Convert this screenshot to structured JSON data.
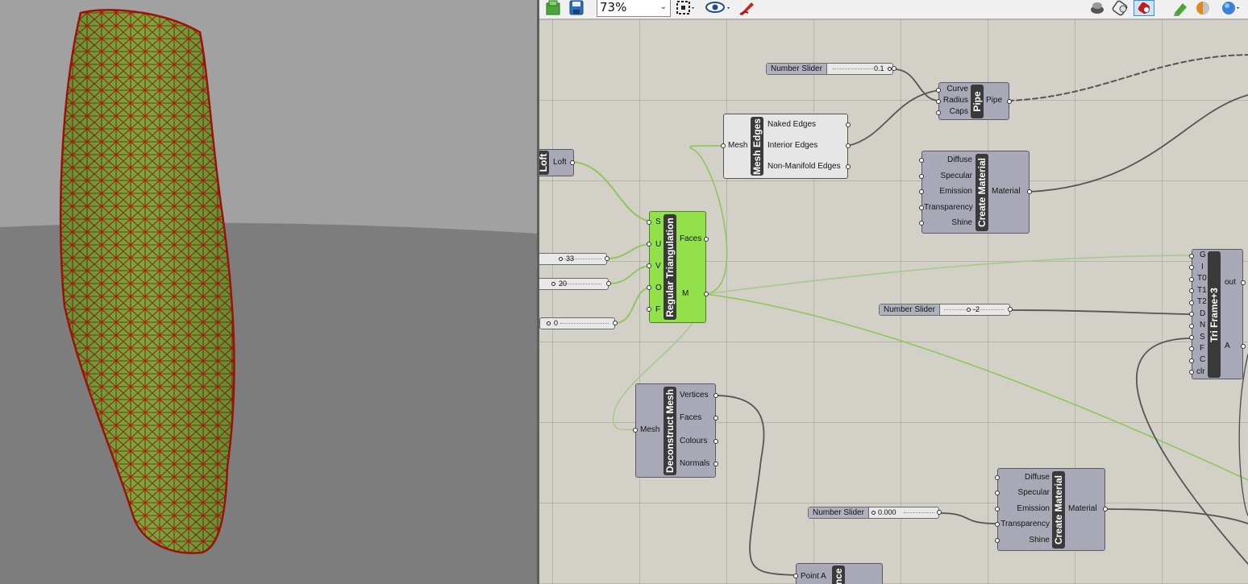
{
  "toolbar": {
    "zoom_value": "73%",
    "icons": [
      "new-file-icon",
      "save-icon",
      "zoom-dropdown",
      "snap-icon",
      "preview-eye-icon",
      "sketch-pen-icon",
      "preview-off-icon",
      "preview-wireframe-icon",
      "preview-shaded-icon",
      "bake-icon",
      "material-icon",
      "sphere-icon"
    ]
  },
  "canvas": {
    "loft": {
      "title": "Loft",
      "output": "Loft"
    },
    "sliders": {
      "u_value": "33",
      "v_value": "20",
      "o_value": "0",
      "radius": {
        "label": "Number Slider",
        "value": "0.1"
      },
      "depth": {
        "label": "Number Slider",
        "value": "-2"
      },
      "transparency": {
        "label": "Number Slider",
        "value": "0.000"
      }
    },
    "regular_triangulation": {
      "title": "Regular Triangulation",
      "inputs": [
        "S",
        "U",
        "V",
        "O",
        "F"
      ],
      "outputs": [
        "Faces",
        "M"
      ]
    },
    "mesh_edges": {
      "title": "Mesh Edges",
      "input": "Mesh",
      "outputs": [
        "Naked Edges",
        "Interior Edges",
        "Non-Manifold Edges"
      ]
    },
    "pipe": {
      "title": "Pipe",
      "inputs": [
        "Curve",
        "Radius",
        "Caps"
      ],
      "output": "Pipe"
    },
    "material_1": {
      "title": "Create Material",
      "inputs": [
        "Diffuse",
        "Specular",
        "Emission",
        "Transparency",
        "Shine"
      ],
      "output": "Material"
    },
    "material_2": {
      "title": "Create Material",
      "inputs": [
        "Diffuse",
        "Specular",
        "Emission",
        "Transparency",
        "Shine"
      ],
      "output": "Material"
    },
    "tri_frame": {
      "title": "Tri Frame+3",
      "inputs": [
        "G",
        "I",
        "T0",
        "T1",
        "T2",
        "D",
        "N",
        "S",
        "F",
        "C",
        "clr"
      ],
      "outputs": [
        "out",
        "A"
      ]
    },
    "deconstruct_mesh": {
      "title": "Deconstruct Mesh",
      "input": "Mesh",
      "outputs": [
        "Vertices",
        "Faces",
        "Colours",
        "Normals"
      ]
    },
    "distance": {
      "title": "nce",
      "input": "Point A"
    }
  },
  "colors": {
    "canvas_bg": "#d3d0c8",
    "component": "#a9a8b7",
    "active_component": "#92e14a",
    "active_wire": "#8cc85a",
    "wire": "#555555",
    "mesh_edge": "#b51d10",
    "mesh_face": "#6fb53e"
  }
}
